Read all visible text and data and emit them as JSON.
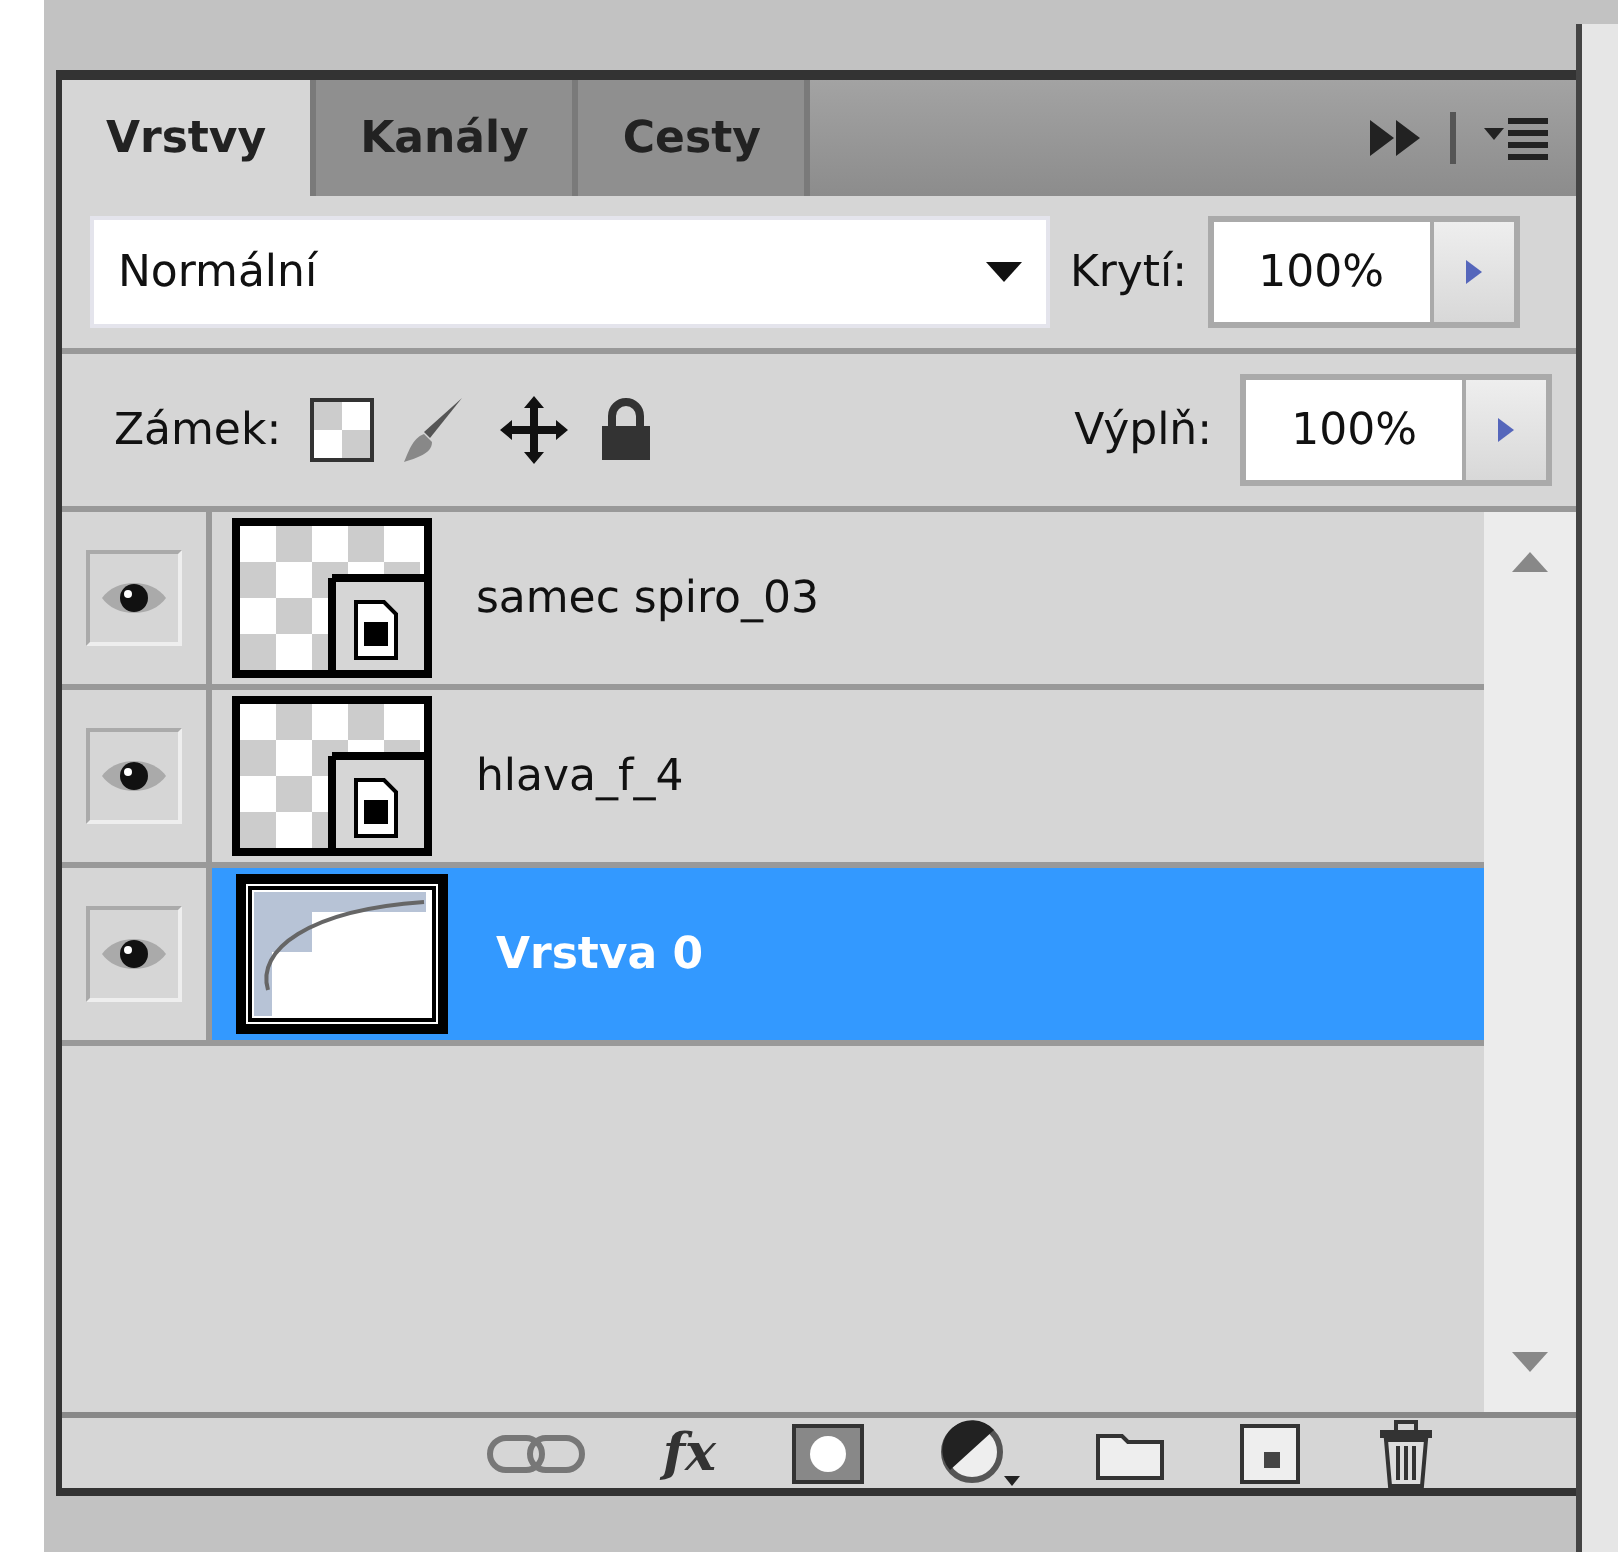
{
  "tabs": [
    {
      "label": "Vrstvy",
      "selected": true
    },
    {
      "label": "Kanály",
      "selected": false
    },
    {
      "label": "Cesty",
      "selected": false
    }
  ],
  "blend_mode": {
    "value": "Normální"
  },
  "opacity": {
    "label": "Krytí:",
    "value": "100%"
  },
  "lock": {
    "label": "Zámek:"
  },
  "fill": {
    "label": "Výplň:",
    "value": "100%"
  },
  "layers": [
    {
      "name": "samec spiro_03",
      "visible": true,
      "selected": false,
      "kind": "smart"
    },
    {
      "name": "hlava_f_4",
      "visible": true,
      "selected": false,
      "kind": "smart"
    },
    {
      "name": "Vrstva 0",
      "visible": true,
      "selected": true,
      "kind": "normal"
    }
  ],
  "footer": {
    "fx_label": "fx"
  }
}
